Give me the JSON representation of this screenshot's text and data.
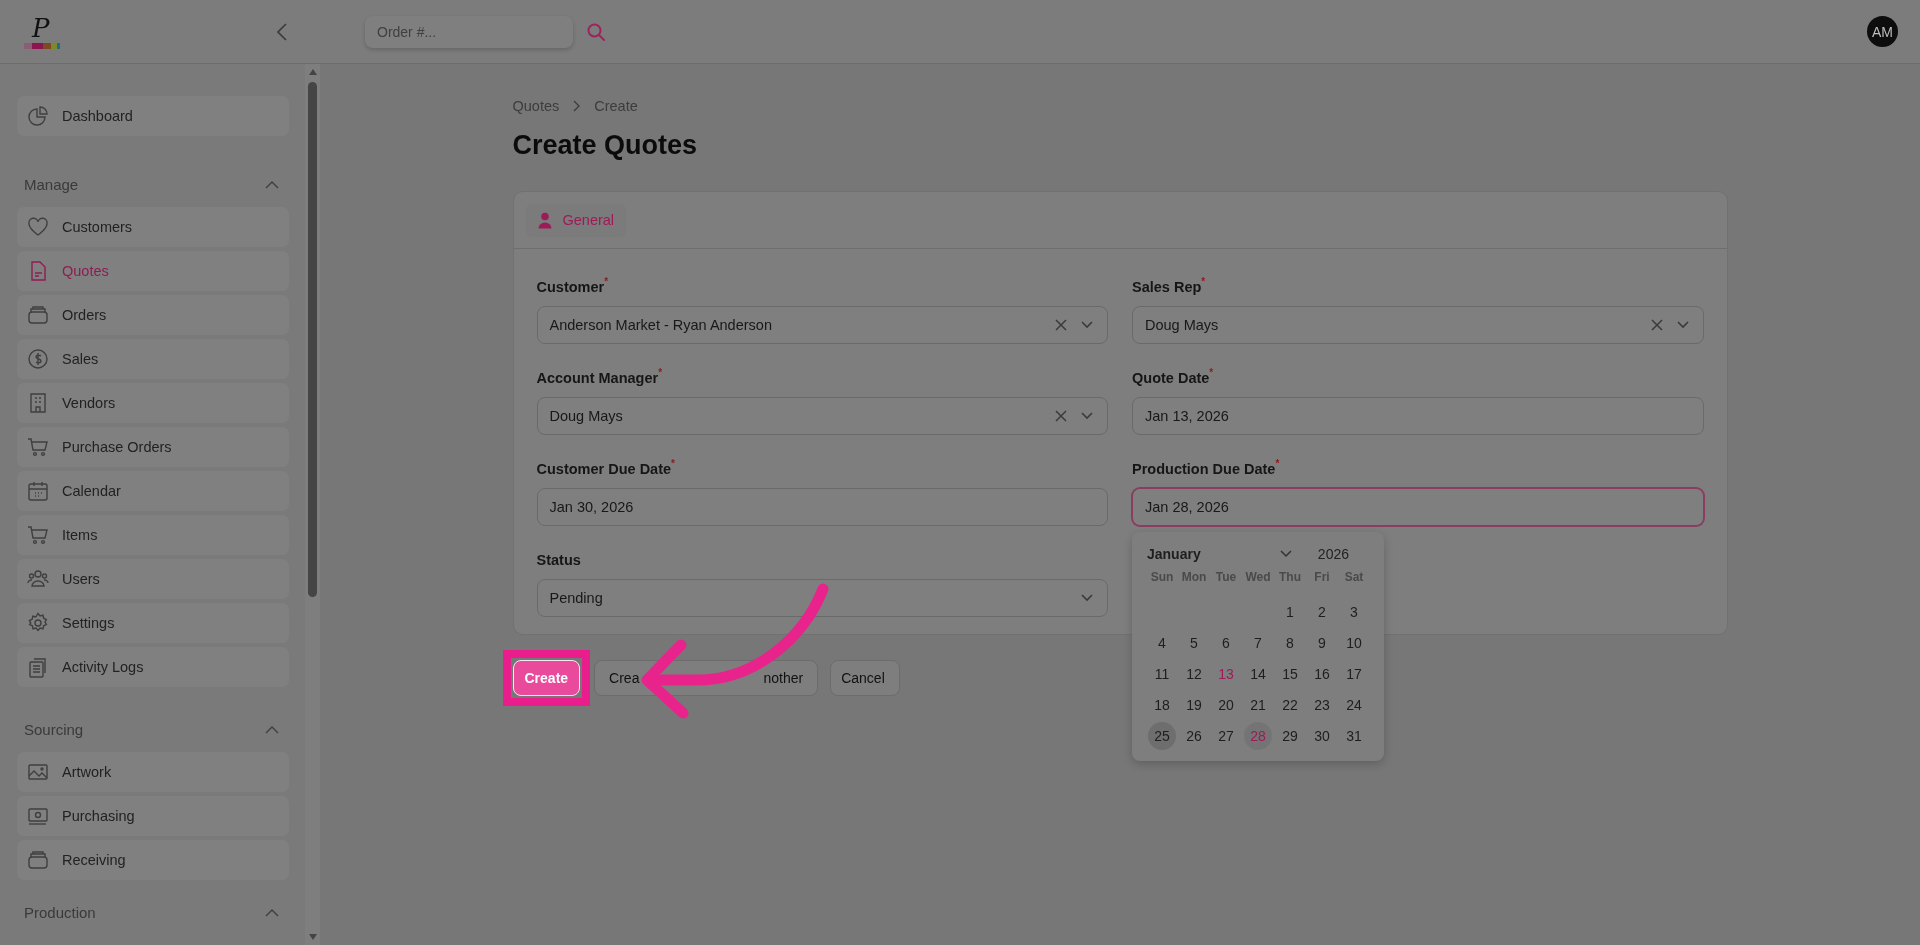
{
  "header": {
    "logo_letter": "P",
    "search": {
      "placeholder": "Order #..."
    },
    "avatar": "AM"
  },
  "sidebar": {
    "sections": [
      {
        "items": [
          {
            "label": "Dashboard",
            "selected": false
          }
        ]
      },
      {
        "title": "Manage",
        "expanded": true,
        "items": [
          {
            "label": "Customers",
            "selected": false
          },
          {
            "label": "Quotes",
            "selected": true
          },
          {
            "label": "Orders",
            "selected": false
          },
          {
            "label": "Sales",
            "selected": false
          },
          {
            "label": "Vendors",
            "selected": false
          },
          {
            "label": "Purchase Orders",
            "selected": false
          },
          {
            "label": "Calendar",
            "selected": false
          },
          {
            "label": "Items",
            "selected": false
          },
          {
            "label": "Users",
            "selected": false
          },
          {
            "label": "Settings",
            "selected": false
          },
          {
            "label": "Activity Logs",
            "selected": false
          }
        ]
      },
      {
        "title": "Sourcing",
        "expanded": true,
        "items": [
          {
            "label": "Artwork",
            "selected": false
          },
          {
            "label": "Purchasing",
            "selected": false
          },
          {
            "label": "Receiving",
            "selected": false
          }
        ]
      },
      {
        "title": "Production",
        "expanded": true
      }
    ]
  },
  "breadcrumb": [
    "Quotes",
    "Create"
  ],
  "title": "Create Quotes",
  "tabs": [
    {
      "label": "General",
      "selected": true
    }
  ],
  "fields": [
    {
      "label": "Customer",
      "required_mark": "*",
      "kind": "select",
      "value": "Anderson Market - Ryan Anderson",
      "clearable": true,
      "open": false
    },
    {
      "label": "Sales Rep",
      "required_mark": "*",
      "kind": "select",
      "value": "Doug Mays",
      "clearable": true,
      "open": false
    },
    {
      "label": "Account Manager",
      "required_mark": "*",
      "kind": "select",
      "value": "Doug Mays",
      "clearable": true,
      "open": false
    },
    {
      "label": "Quote Date",
      "required_mark": "*",
      "kind": "date",
      "value": "Jan 13, 2026",
      "clearable": false,
      "open": false
    },
    {
      "label": "Customer Due Date",
      "required_mark": "*",
      "kind": "date",
      "value": "Jan 30, 2026",
      "clearable": false,
      "open": false
    },
    {
      "label": "Production Due Date",
      "required_mark": "*",
      "kind": "date",
      "value": "Jan 28, 2026",
      "clearable": false,
      "open": true
    },
    {
      "label": "Status",
      "kind": "select",
      "value": "Pending",
      "clearable": false,
      "open": false
    }
  ],
  "calendar": {
    "month": "January",
    "year": "2026",
    "weekdays": [
      "Sun",
      "Mon",
      "Tue",
      "Wed",
      "Thu",
      "Fri",
      "Sat"
    ],
    "weeks": [
      [
        {
          "label": "1",
          "kind": "plain",
          "selected": false
        },
        {
          "label": "2",
          "kind": "plain",
          "selected": false
        },
        {
          "label": "3",
          "kind": "plain",
          "selected": false
        }
      ],
      [
        {
          "label": "4",
          "kind": "plain",
          "selected": false
        },
        {
          "label": "5",
          "kind": "plain",
          "selected": false
        },
        {
          "label": "6",
          "kind": "plain",
          "selected": false
        },
        {
          "label": "7",
          "kind": "plain",
          "selected": false
        },
        {
          "label": "8",
          "kind": "plain",
          "selected": false
        },
        {
          "label": "9",
          "kind": "plain",
          "selected": false
        },
        {
          "label": "10",
          "kind": "plain",
          "selected": false
        }
      ],
      [
        {
          "label": "11",
          "kind": "plain",
          "selected": false
        },
        {
          "label": "12",
          "kind": "plain",
          "selected": false
        },
        {
          "label": "13",
          "kind": "marked",
          "selected": false
        },
        {
          "label": "14",
          "kind": "plain",
          "selected": false
        },
        {
          "label": "15",
          "kind": "plain",
          "selected": false
        },
        {
          "label": "16",
          "kind": "plain",
          "selected": false
        },
        {
          "label": "17",
          "kind": "plain",
          "selected": false
        }
      ],
      [
        {
          "label": "18",
          "kind": "plain",
          "selected": false
        },
        {
          "label": "19",
          "kind": "plain",
          "selected": false
        },
        {
          "label": "20",
          "kind": "plain",
          "selected": false
        },
        {
          "label": "21",
          "kind": "plain",
          "selected": false
        },
        {
          "label": "22",
          "kind": "plain",
          "selected": false
        },
        {
          "label": "23",
          "kind": "plain",
          "selected": false
        },
        {
          "label": "24",
          "kind": "plain",
          "selected": false
        }
      ],
      [
        {
          "label": "25",
          "kind": "hover",
          "selected": false
        },
        {
          "label": "26",
          "kind": "plain",
          "selected": false
        },
        {
          "label": "27",
          "kind": "plain",
          "selected": false
        },
        {
          "label": "28",
          "kind": "plain",
          "selected": true
        },
        {
          "label": "29",
          "kind": "plain",
          "selected": false
        },
        {
          "label": "30",
          "kind": "plain",
          "selected": false
        },
        {
          "label": "31",
          "kind": "plain",
          "selected": false
        }
      ]
    ]
  },
  "buttons": [
    {
      "kind": "primary",
      "label_parts": [
        "Create"
      ],
      "highlighted": true
    },
    {
      "kind": "secondary",
      "label_parts": [
        "Crea",
        "nother"
      ],
      "highlighted": false
    },
    {
      "kind": "secondary",
      "label_parts": [
        "Cancel"
      ],
      "highlighted": false
    }
  ]
}
